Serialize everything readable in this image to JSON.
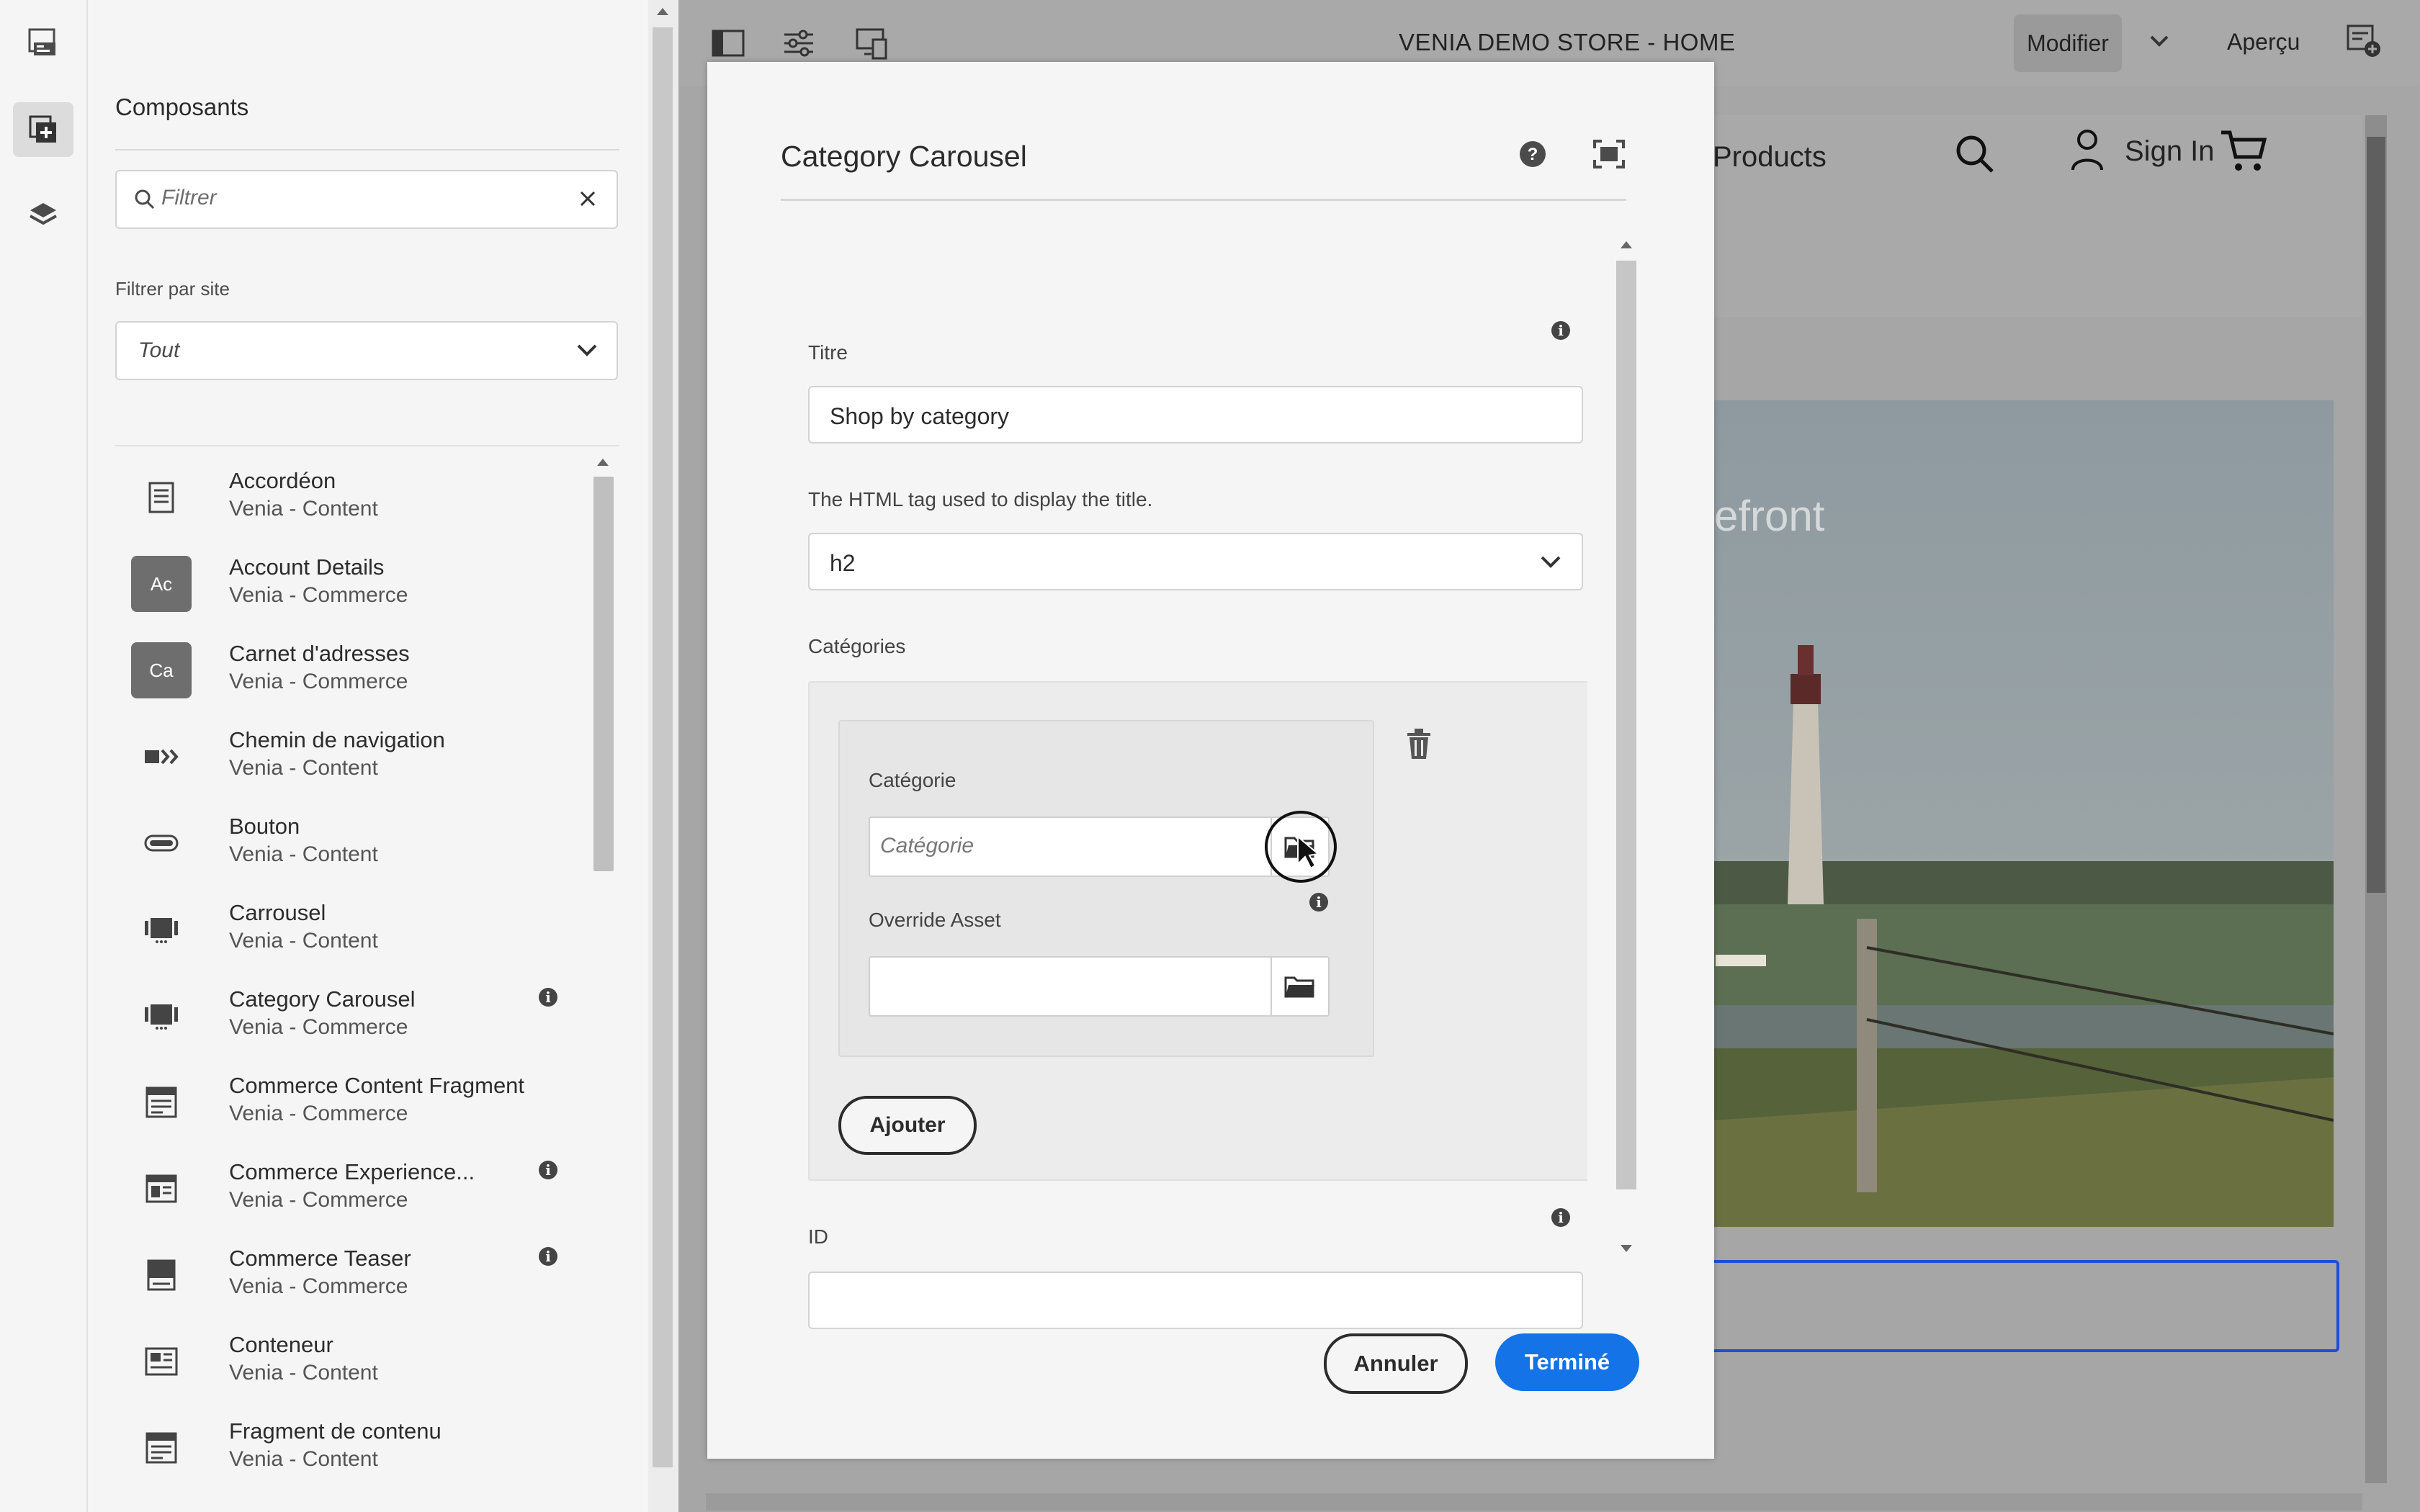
{
  "toolbar": {
    "page_title": "VENIA DEMO STORE - HOME",
    "modify_label": "Modifier",
    "preview_label": "Aperçu"
  },
  "panel": {
    "title": "Composants",
    "filter_placeholder": "Filtrer",
    "site_filter_label": "Filtrer par site",
    "site_filter_value": "Tout",
    "components": [
      {
        "title": "Accordéon",
        "group": "Venia - Content",
        "icon": "accordion-icon",
        "info": false
      },
      {
        "title": "Account Details",
        "group": "Venia - Commerce",
        "icon": "badge",
        "badge": "Ac",
        "info": false
      },
      {
        "title": "Carnet d'adresses",
        "group": "Venia - Commerce",
        "icon": "badge",
        "badge": "Ca",
        "info": false
      },
      {
        "title": "Chemin de navigation",
        "group": "Venia - Content",
        "icon": "breadcrumb-icon",
        "info": false
      },
      {
        "title": "Bouton",
        "group": "Venia - Content",
        "icon": "button-icon",
        "info": false
      },
      {
        "title": "Carrousel",
        "group": "Venia - Content",
        "icon": "carousel-icon",
        "info": false
      },
      {
        "title": "Category Carousel",
        "group": "Venia - Commerce",
        "icon": "carousel-icon",
        "info": true
      },
      {
        "title": "Commerce Content Fragment",
        "group": "Venia - Commerce",
        "icon": "content-fragment-icon",
        "info": false
      },
      {
        "title": "Commerce Experience...",
        "group": "Venia - Commerce",
        "icon": "experience-fragment-icon",
        "info": true
      },
      {
        "title": "Commerce Teaser",
        "group": "Venia - Commerce",
        "icon": "teaser-icon",
        "info": true
      },
      {
        "title": "Conteneur",
        "group": "Venia - Content",
        "icon": "container-icon",
        "info": false
      },
      {
        "title": "Fragment de contenu",
        "group": "Venia - Content",
        "icon": "content-fragment-icon",
        "info": false
      }
    ]
  },
  "site": {
    "products_label": "Products",
    "signin_label": "Sign In",
    "hero_text_fragment": "efront"
  },
  "dialog": {
    "title": "Category Carousel",
    "title_label": "Titre",
    "title_value": "Shop by category",
    "tag_label": "The HTML tag used to display the title.",
    "tag_value": "h2",
    "categories_label": "Catégories",
    "category_label": "Catégorie",
    "category_placeholder": "Catégorie",
    "override_asset_label": "Override Asset",
    "add_label": "Ajouter",
    "id_label": "ID",
    "cancel_label": "Annuler",
    "done_label": "Terminé"
  },
  "colors": {
    "accent": "#1473e6",
    "selection_outline": "#1d4ed8",
    "overlay": "#a6a6a6"
  }
}
